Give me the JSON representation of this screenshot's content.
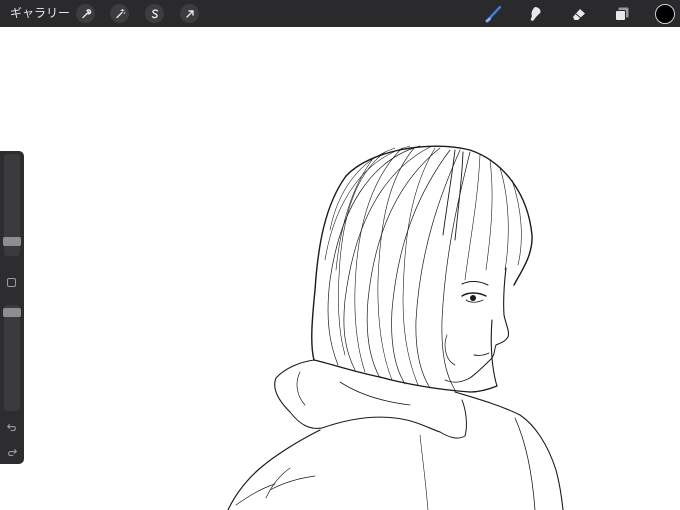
{
  "topbar": {
    "gallery_label": "ギャラリー",
    "left_tools": [
      {
        "name": "wrench-icon"
      },
      {
        "name": "magic-wand-icon"
      },
      {
        "name": "selection-s-icon"
      },
      {
        "name": "move-arrow-icon"
      }
    ],
    "right_tools": [
      {
        "name": "brush-icon",
        "active": true
      },
      {
        "name": "smudge-icon",
        "active": false
      },
      {
        "name": "eraser-icon",
        "active": false
      },
      {
        "name": "layers-icon",
        "active": false
      }
    ],
    "current_color": "#000000",
    "active_tool_color": "#3b7de0"
  },
  "sidebar": {
    "brush_size_level": 0.3,
    "opacity_level": 1.0,
    "undo_icon": "undo-icon",
    "redo_icon": "redo-icon"
  },
  "canvas": {
    "background": "#ffffff",
    "content": "pencil-sketch-girl"
  }
}
